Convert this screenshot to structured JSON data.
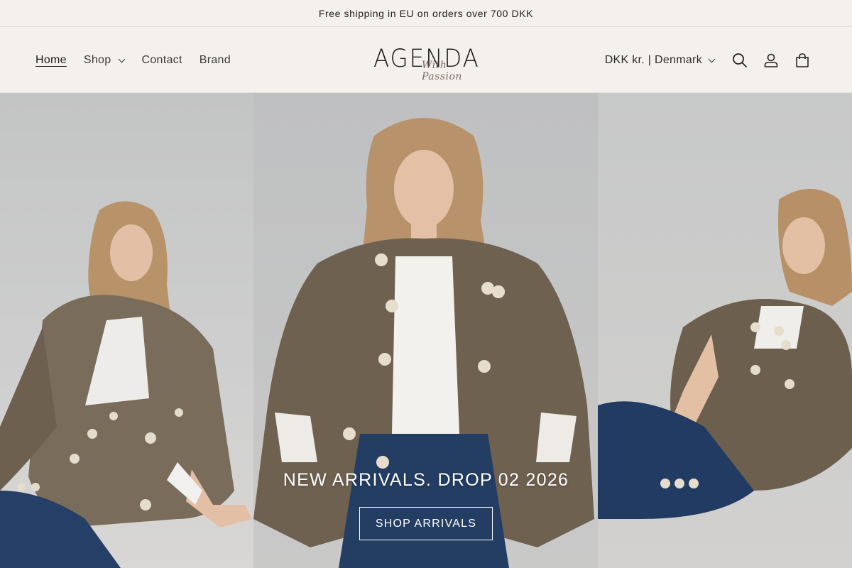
{
  "announcement": {
    "text": "Free shipping in EU on orders over 700 DKK"
  },
  "nav": {
    "items": [
      {
        "label": "Home"
      },
      {
        "label": "Shop"
      },
      {
        "label": "Contact"
      },
      {
        "label": "Brand"
      }
    ]
  },
  "logo": {
    "main": "AGENDA",
    "sub": "With Passion"
  },
  "header_tools": {
    "currency": "DKK kr. | Denmark",
    "search_icon": "search-icon",
    "account_icon": "account-icon",
    "cart_icon": "cart-icon"
  },
  "hero": {
    "title": "NEW ARRIVALS. DROP 02 2026",
    "cta": "SHOP ARRIVALS"
  },
  "colors": {
    "background": "#f4f1ec",
    "text": "#1a1a1a",
    "hero_text": "#ffffff"
  }
}
